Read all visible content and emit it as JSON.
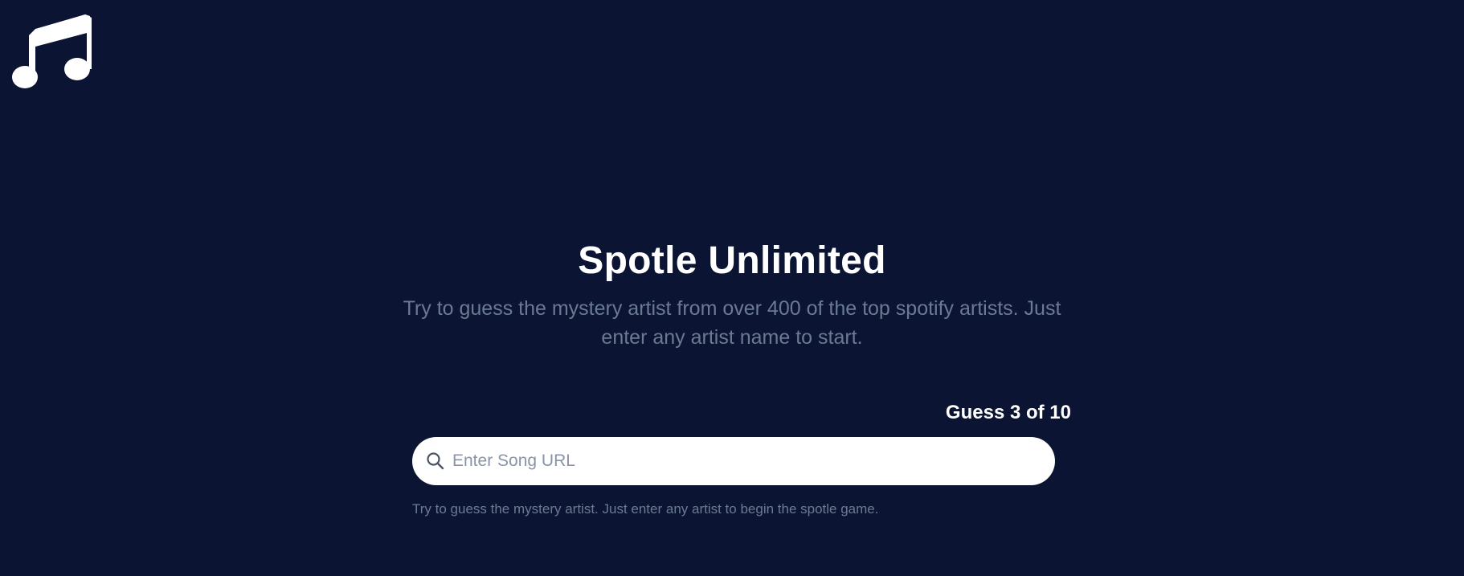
{
  "app": {
    "logo_icon": "music-note-icon"
  },
  "hero": {
    "title": "Spotle Unlimited",
    "subtitle": "Try to guess the mystery artist from over 400 of the top spotify artists. Just enter any artist name to start."
  },
  "game": {
    "guess_counter": "Guess 3 of 10",
    "search": {
      "icon": "search-icon",
      "placeholder": "Enter Song URL",
      "value": ""
    },
    "hint": "Try to guess the mystery artist. Just enter any artist to begin the spotle game."
  },
  "colors": {
    "background": "#0b1533",
    "text_primary": "#ffffff",
    "text_muted": "#6b7a93"
  }
}
